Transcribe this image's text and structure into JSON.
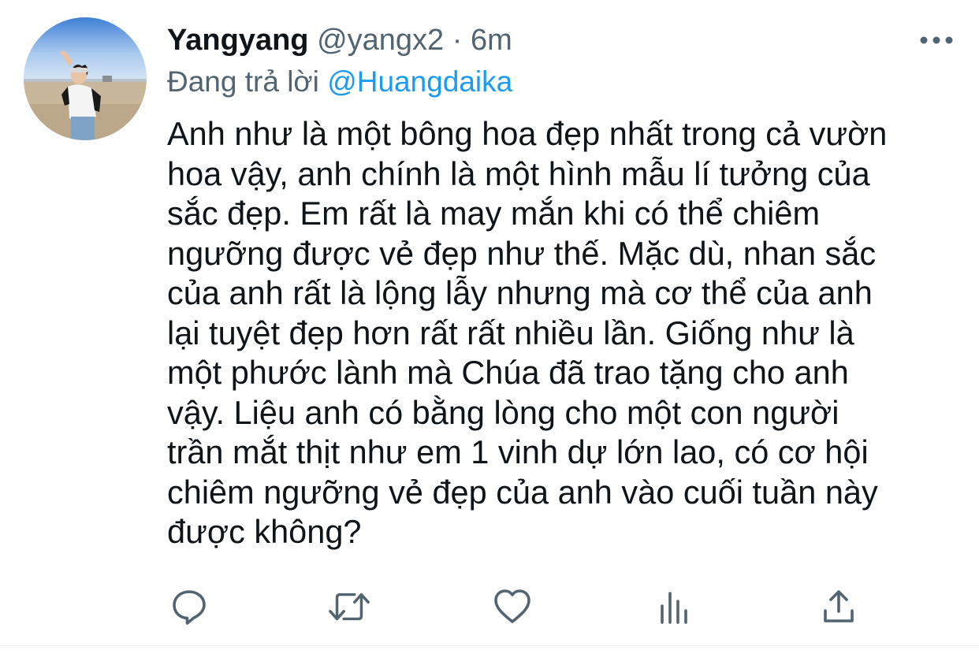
{
  "tweet": {
    "display_name": "Yangyang",
    "handle": "@yangx2",
    "separator": "·",
    "time": "6m",
    "reply_prefix": "Đang trả lời",
    "reply_to": "@Huangdaika",
    "text": "Anh như là một bông hoa đẹp nhất trong cả vườn\nhoa vậy, anh chính là một hình mẫu lí tưởng của\nsắc đẹp. Em rất là may mắn khi có thể chiêm\nngưỡng được vẻ đẹp như thế. Mặc dù, nhan sắc\ncủa anh rất là lộng lẫy nhưng mà cơ thể của anh\nlại tuyệt đẹp hơn rất rất nhiều lần. Giống như là\nmột phước lành mà Chúa đã trao tặng cho anh\nvậy. Liệu anh có bằng lòng cho một con người\ntrần mắt thịt như em 1 vinh dự lớn lao, có cơ hội\nchiêm ngưỡng vẻ đẹp của anh vào cuối tuần này\nđược không?"
  },
  "icons": {
    "avatar": "profile-photo",
    "more": "more-horizontal-icon",
    "reply": "reply-icon",
    "retweet": "retweet-icon",
    "like": "heart-icon",
    "analytics": "analytics-icon",
    "share": "share-icon"
  },
  "colors": {
    "text": "#0f1419",
    "secondary": "#536471",
    "link": "#1d9bf0",
    "divider": "#eff3f4"
  }
}
